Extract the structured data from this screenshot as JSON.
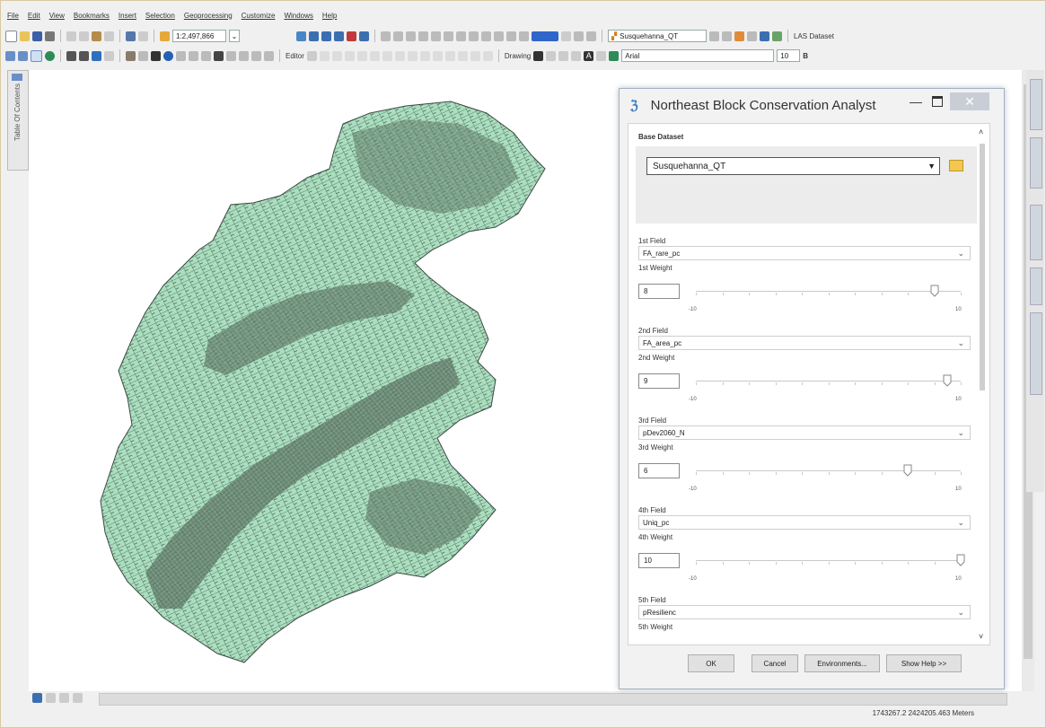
{
  "menu": [
    "File",
    "Edit",
    "View",
    "Bookmarks",
    "Insert",
    "Selection",
    "Geoprocessing",
    "Customize",
    "Windows",
    "Help"
  ],
  "toolbar": {
    "scale": "1:2,497,866",
    "layer": "Susquehanna_QT",
    "las_label": "LAS Dataset",
    "editor_label": "Editor",
    "drawing_label": "Drawing",
    "font": "Arial",
    "font_size": "10"
  },
  "toc_label": "Table Of Contents",
  "status": {
    "coords": "1743267.2  2424205.463 Meters"
  },
  "colors": {
    "polygon_fill": "#a9dfbf",
    "polygon_stroke": "#4a5a50",
    "accent": "#3a7dc2"
  },
  "dialog": {
    "title": "Northeast Block Conservation Analyst",
    "base_label": "Base Dataset",
    "base_value": "Susquehanna_QT",
    "fields": [
      {
        "field_label": "1st Field",
        "field_value": "FA_rare_pc",
        "weight_label": "1st Weight",
        "weight": "8",
        "level": 8,
        "min": "-10",
        "max": "10"
      },
      {
        "field_label": "2nd Field",
        "field_value": "FA_area_pc",
        "weight_label": "2nd Weight",
        "weight": "9",
        "level": 9,
        "min": "-10",
        "max": "10"
      },
      {
        "field_label": "3rd Field",
        "field_value": "pDev2060_N",
        "weight_label": "3rd Weight",
        "weight": "6",
        "level": 6,
        "min": "-10",
        "max": "10"
      },
      {
        "field_label": "4th Field",
        "field_value": "Uniq_pc",
        "weight_label": "4th Weight",
        "weight": "10",
        "level": 10,
        "min": "-10",
        "max": "10"
      },
      {
        "field_label": "5th Field",
        "field_value": "pResilienc",
        "weight_label": "5th Weight"
      }
    ],
    "buttons": {
      "ok": "OK",
      "cancel": "Cancel",
      "env": "Environments...",
      "help": "Show Help >>"
    }
  }
}
